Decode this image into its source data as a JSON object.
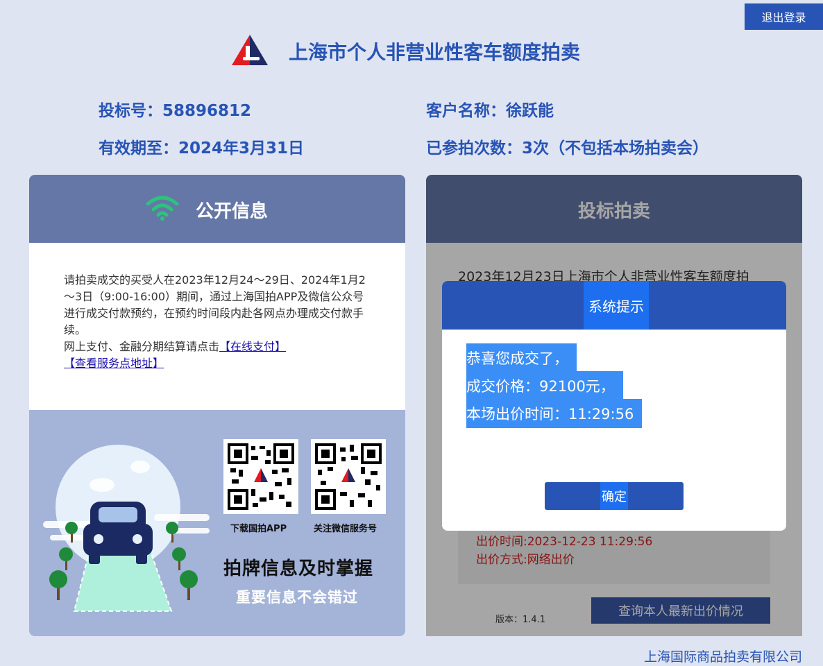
{
  "header": {
    "logout_label": "退出登录",
    "title": "上海市个人非营业性客车额度拍卖"
  },
  "user_info": {
    "bid_number": "投标号：58896812",
    "customer_name": "客户名称：徐跃能",
    "valid_until": "有效期至：2024年3月31日",
    "participation_count": "已参拍次数：3次（不包括本场拍卖会）"
  },
  "public_info": {
    "title": "公开信息",
    "notice_text": "请拍卖成交的买受人在2023年12月24～29日、2024年1月2～3日（9:00-16:00）期间，通过上海国拍APP及微信公众号进行成交付款预约，在预约时间段内赴各网点办理成交付款手续。",
    "online_prefix": "网上支付、金融分期结算请点击",
    "online_pay_link": "【在线支付】",
    "service_link": "【查看服务点地址】",
    "qr_app_label": "下载国拍APP",
    "qr_wechat_label": "关注微信服务号",
    "slogan_main": "拍牌信息及时掌握",
    "slogan_sub": "重要信息不会错过"
  },
  "bidding": {
    "title": "投标拍卖",
    "auction_text": "2023年12月23日上海市个人非营业性客车额度拍",
    "bid_time": "出价时间:2023-12-23 11:29:56",
    "bid_method": "出价方式:网络出价",
    "version": "版本：1.4.1",
    "query_button": "查询本人最新出价情况"
  },
  "modal": {
    "title": "系统提示",
    "line1": "恭喜您成交了，",
    "line2": "成交价格：92100元，",
    "line3": "本场出价时间：11:29:56",
    "ok_label": "确定"
  },
  "footer": {
    "company": "上海国际商品拍卖有限公司"
  },
  "colors": {
    "brand_blue": "#2854b5",
    "panel_header": "#6577a6",
    "page_background": "#dee4f1",
    "bid_red": "#d02020",
    "wifi_green": "#2ec27e"
  }
}
